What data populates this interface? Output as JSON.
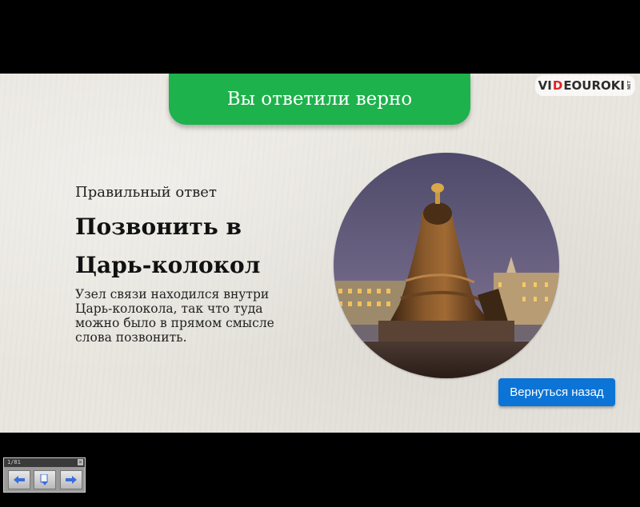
{
  "banner": {
    "text": "Вы ответили верно",
    "color": "#1db24b"
  },
  "logo": {
    "part1": "VI",
    "part2": "D",
    "part3": "EOUROKI",
    "suffix": "NET"
  },
  "content": {
    "subtitle": "Правильный ответ",
    "answer_line1": "Позвонить в",
    "answer_line2": "Царь-колокол",
    "description": "Узел связи находился внутри Царь-колокола, так что туда можно было в прямом смысле слова позвонить."
  },
  "image": {
    "icon": "tsar-bell-photo"
  },
  "buttons": {
    "back_label": "Вернуться назад",
    "back_color": "#0c74d6"
  },
  "navigator": {
    "counter": "1/81",
    "close": "×",
    "icons": [
      "arrow-left-icon",
      "page-list-icon",
      "arrow-right-icon"
    ]
  }
}
